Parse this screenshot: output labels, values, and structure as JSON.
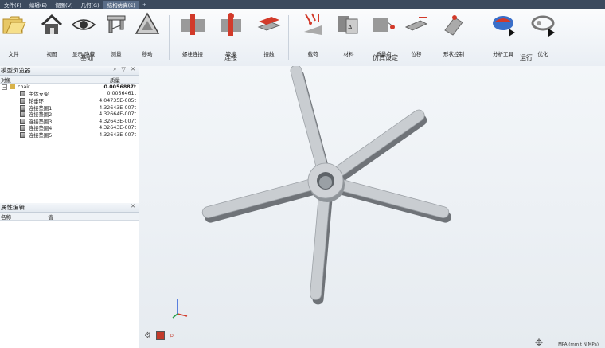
{
  "menu": {
    "items": [
      "文件(F)",
      "编辑(E)",
      "视图(V)",
      "几何(G)",
      "结构仿真(S)"
    ],
    "active_index": 4,
    "plus": "+"
  },
  "ribbon": {
    "tools": [
      {
        "label": "文件",
        "icon": "folder-icon"
      },
      {
        "label": "视图",
        "icon": "house-icon"
      },
      {
        "label": "显示/隐藏",
        "icon": "eye-icon"
      },
      {
        "label": "测量",
        "icon": "caliper-icon"
      },
      {
        "label": "移动",
        "icon": "move-icon"
      },
      {
        "label": "螺栓连接",
        "icon": "bolt-icon"
      },
      {
        "label": "铰接",
        "icon": "hinge-icon"
      },
      {
        "label": "接触",
        "icon": "contact-icon"
      },
      {
        "label": "载荷",
        "icon": "load-icon"
      },
      {
        "label": "材料",
        "icon": "material-icon"
      },
      {
        "label": "质量点",
        "icon": "mass-point-icon"
      },
      {
        "label": "位移",
        "icon": "displacement-icon"
      },
      {
        "label": "形状控制",
        "icon": "shape-control-icon"
      },
      {
        "label": "分析工具",
        "icon": "analysis-tool-icon"
      },
      {
        "label": "优化",
        "icon": "optimize-icon"
      }
    ],
    "groups": {
      "basic": "基础",
      "connect": "连接",
      "sim_setup": "仿真设定",
      "run": "运行"
    }
  },
  "model_browser": {
    "title": "模型浏览器",
    "controls": "⌕ ▽ ✕",
    "col_object": "对象",
    "col_mass": "质量",
    "root": {
      "name": "chair",
      "mass": "0.0056887t"
    },
    "items": [
      {
        "name": "主体支架",
        "mass": "0.0056461t"
      },
      {
        "name": "轮垂环",
        "mass": "4.04735E-005t"
      },
      {
        "name": "连接垫圈1",
        "mass": "4.32643E-007t"
      },
      {
        "name": "连接垫圈2",
        "mass": "4.32664E-007t"
      },
      {
        "name": "连接垫圈3",
        "mass": "4.32643E-007t"
      },
      {
        "name": "连接垫圈4",
        "mass": "4.32643E-007t"
      },
      {
        "name": "连接垫圈5",
        "mass": "4.32643E-007t"
      }
    ]
  },
  "property_editor": {
    "title": "属性编辑",
    "close": "✕",
    "col_name": "名称",
    "col_value": "值"
  },
  "status": {
    "units": "MPA (mm t N MPa)"
  },
  "colors": {
    "menubar": "#3c4a5e",
    "accent": "#d23a2a",
    "part": "#c9cdd1"
  }
}
